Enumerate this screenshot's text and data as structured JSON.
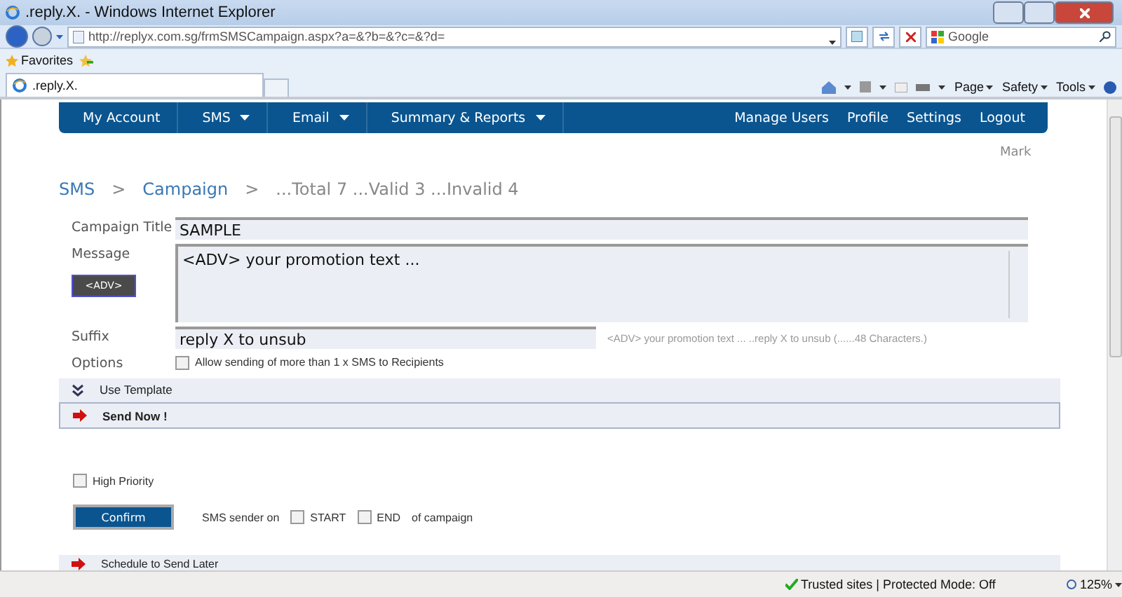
{
  "browser": {
    "title": ".reply.X. - Windows Internet Explorer",
    "address": "http://replyx.com.sg/frmSMSCampaign.aspx?a=&?b=&?c=&?d=",
    "search_placeholder": "Google",
    "favorites": "Favorites",
    "tab": ".reply.X.",
    "commands": [
      "Page",
      "Safety",
      "Tools"
    ]
  },
  "nav": {
    "left": [
      {
        "label": "My Account",
        "dropdown": false
      },
      {
        "label": "SMS",
        "dropdown": true
      },
      {
        "label": "Email",
        "dropdown": true
      },
      {
        "label": "Summary & Reports",
        "dropdown": true
      }
    ],
    "right": [
      "Manage Users",
      "Profile",
      "Settings",
      "Logout"
    ]
  },
  "user": "Mark",
  "breadcrumb": {
    "separator": ">",
    "links": [
      "SMS",
      "Campaign"
    ],
    "status": "...Total 7 ...Valid 3 ...Invalid 4"
  },
  "form": {
    "campaign_title": {
      "label": "Campaign Title",
      "value": "SAMPLE"
    },
    "message": {
      "label": "Message",
      "value": "<ADV> your promotion text ...",
      "insert_button": "<ADV>"
    },
    "suffix": {
      "label": "Suffix",
      "value": "reply X to unsub",
      "preview": "<ADV> your promotion text ... ..reply X to unsub (......48 Characters.)"
    },
    "options": {
      "label": "Options",
      "checkbox": {
        "label": "Allow sending of more than 1 x SMS to Recipients",
        "checked": false
      }
    }
  },
  "sections": [
    {
      "kind": "expand",
      "label": "Use Template",
      "selected": false
    },
    {
      "kind": "arrow",
      "label": "Send Now !",
      "selected": true
    }
  ],
  "send_now": {
    "high_priority": {
      "label": "High Priority",
      "checked": false
    },
    "confirm": "Confirm",
    "sender_prefix": "SMS sender on",
    "sender_options": [
      {
        "label": "START",
        "checked": false
      },
      {
        "label": "END",
        "checked": false
      }
    ],
    "sender_suffix": "of campaign"
  },
  "schedule": {
    "label": "Schedule to Send Later"
  },
  "status_bar": {
    "zone": "Trusted sites | Protected Mode: Off",
    "zoom": "125%"
  }
}
